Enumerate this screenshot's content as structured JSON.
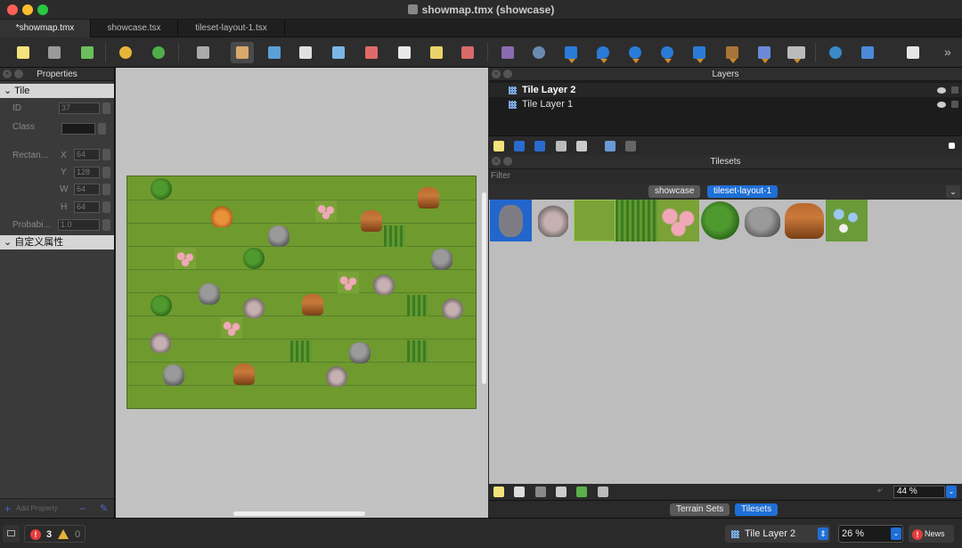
{
  "window": {
    "title": "showmap.tmx (showcase)"
  },
  "tabs": [
    {
      "label": "*showmap.tmx"
    },
    {
      "label": "showcase.tsx"
    },
    {
      "label": "tileset-layout-1.tsx"
    }
  ],
  "properties": {
    "header": "Properties",
    "group_tile": "Tile",
    "id_label": "ID",
    "id_value": "37",
    "class_label": "Class",
    "rect_label": "Rectan...",
    "x_label": "X",
    "x_value": "64",
    "y_label": "Y",
    "y_value": "128",
    "w_label": "W",
    "w_value": "64",
    "h_label": "H",
    "h_value": "64",
    "prob_label": "Probabi...",
    "prob_value": "1.0",
    "group_custom": "自定义属性",
    "add_property": "Add Property"
  },
  "layers": {
    "header": "Layers",
    "items": [
      {
        "name": "Tile Layer 2",
        "selected": true
      },
      {
        "name": "Tile Layer 1",
        "selected": false
      }
    ]
  },
  "tilesets": {
    "header": "Tilesets",
    "filter_placeholder": "Filter",
    "tabs": [
      {
        "label": "showcase",
        "active": false
      },
      {
        "label": "tileset-layout-1",
        "active": true
      }
    ],
    "zoom": "44 %",
    "bottom_tabs": [
      {
        "label": "Terrain Sets",
        "active": false
      },
      {
        "label": "Tilesets",
        "active": true
      }
    ]
  },
  "status": {
    "errors": "3",
    "warnings": "0",
    "layer_select": "Tile Layer 2",
    "zoom": "26 %",
    "news": "News"
  },
  "colors": {
    "accent": "#1f6fd6",
    "error": "#e53b3b",
    "warning": "#e3b23a"
  }
}
